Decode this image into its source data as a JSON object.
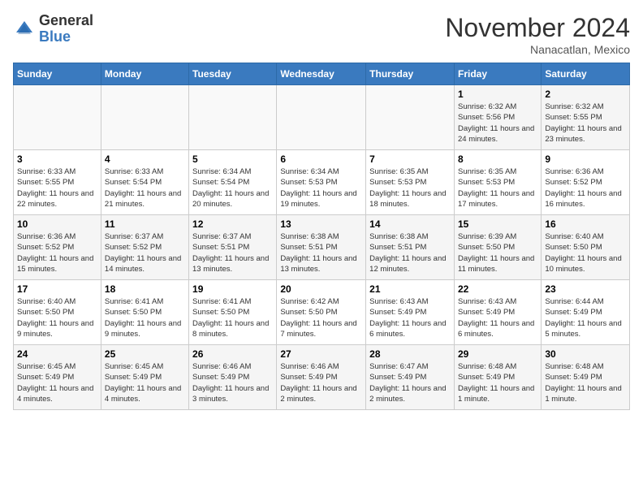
{
  "header": {
    "logo_general": "General",
    "logo_blue": "Blue",
    "month_title": "November 2024",
    "subtitle": "Nanacatlan, Mexico"
  },
  "days_of_week": [
    "Sunday",
    "Monday",
    "Tuesday",
    "Wednesday",
    "Thursday",
    "Friday",
    "Saturday"
  ],
  "weeks": [
    [
      {
        "day": "",
        "info": ""
      },
      {
        "day": "",
        "info": ""
      },
      {
        "day": "",
        "info": ""
      },
      {
        "day": "",
        "info": ""
      },
      {
        "day": "",
        "info": ""
      },
      {
        "day": "1",
        "info": "Sunrise: 6:32 AM\nSunset: 5:56 PM\nDaylight: 11 hours and 24 minutes."
      },
      {
        "day": "2",
        "info": "Sunrise: 6:32 AM\nSunset: 5:55 PM\nDaylight: 11 hours and 23 minutes."
      }
    ],
    [
      {
        "day": "3",
        "info": "Sunrise: 6:33 AM\nSunset: 5:55 PM\nDaylight: 11 hours and 22 minutes."
      },
      {
        "day": "4",
        "info": "Sunrise: 6:33 AM\nSunset: 5:54 PM\nDaylight: 11 hours and 21 minutes."
      },
      {
        "day": "5",
        "info": "Sunrise: 6:34 AM\nSunset: 5:54 PM\nDaylight: 11 hours and 20 minutes."
      },
      {
        "day": "6",
        "info": "Sunrise: 6:34 AM\nSunset: 5:53 PM\nDaylight: 11 hours and 19 minutes."
      },
      {
        "day": "7",
        "info": "Sunrise: 6:35 AM\nSunset: 5:53 PM\nDaylight: 11 hours and 18 minutes."
      },
      {
        "day": "8",
        "info": "Sunrise: 6:35 AM\nSunset: 5:53 PM\nDaylight: 11 hours and 17 minutes."
      },
      {
        "day": "9",
        "info": "Sunrise: 6:36 AM\nSunset: 5:52 PM\nDaylight: 11 hours and 16 minutes."
      }
    ],
    [
      {
        "day": "10",
        "info": "Sunrise: 6:36 AM\nSunset: 5:52 PM\nDaylight: 11 hours and 15 minutes."
      },
      {
        "day": "11",
        "info": "Sunrise: 6:37 AM\nSunset: 5:52 PM\nDaylight: 11 hours and 14 minutes."
      },
      {
        "day": "12",
        "info": "Sunrise: 6:37 AM\nSunset: 5:51 PM\nDaylight: 11 hours and 13 minutes."
      },
      {
        "day": "13",
        "info": "Sunrise: 6:38 AM\nSunset: 5:51 PM\nDaylight: 11 hours and 13 minutes."
      },
      {
        "day": "14",
        "info": "Sunrise: 6:38 AM\nSunset: 5:51 PM\nDaylight: 11 hours and 12 minutes."
      },
      {
        "day": "15",
        "info": "Sunrise: 6:39 AM\nSunset: 5:50 PM\nDaylight: 11 hours and 11 minutes."
      },
      {
        "day": "16",
        "info": "Sunrise: 6:40 AM\nSunset: 5:50 PM\nDaylight: 11 hours and 10 minutes."
      }
    ],
    [
      {
        "day": "17",
        "info": "Sunrise: 6:40 AM\nSunset: 5:50 PM\nDaylight: 11 hours and 9 minutes."
      },
      {
        "day": "18",
        "info": "Sunrise: 6:41 AM\nSunset: 5:50 PM\nDaylight: 11 hours and 9 minutes."
      },
      {
        "day": "19",
        "info": "Sunrise: 6:41 AM\nSunset: 5:50 PM\nDaylight: 11 hours and 8 minutes."
      },
      {
        "day": "20",
        "info": "Sunrise: 6:42 AM\nSunset: 5:50 PM\nDaylight: 11 hours and 7 minutes."
      },
      {
        "day": "21",
        "info": "Sunrise: 6:43 AM\nSunset: 5:49 PM\nDaylight: 11 hours and 6 minutes."
      },
      {
        "day": "22",
        "info": "Sunrise: 6:43 AM\nSunset: 5:49 PM\nDaylight: 11 hours and 6 minutes."
      },
      {
        "day": "23",
        "info": "Sunrise: 6:44 AM\nSunset: 5:49 PM\nDaylight: 11 hours and 5 minutes."
      }
    ],
    [
      {
        "day": "24",
        "info": "Sunrise: 6:45 AM\nSunset: 5:49 PM\nDaylight: 11 hours and 4 minutes."
      },
      {
        "day": "25",
        "info": "Sunrise: 6:45 AM\nSunset: 5:49 PM\nDaylight: 11 hours and 4 minutes."
      },
      {
        "day": "26",
        "info": "Sunrise: 6:46 AM\nSunset: 5:49 PM\nDaylight: 11 hours and 3 minutes."
      },
      {
        "day": "27",
        "info": "Sunrise: 6:46 AM\nSunset: 5:49 PM\nDaylight: 11 hours and 2 minutes."
      },
      {
        "day": "28",
        "info": "Sunrise: 6:47 AM\nSunset: 5:49 PM\nDaylight: 11 hours and 2 minutes."
      },
      {
        "day": "29",
        "info": "Sunrise: 6:48 AM\nSunset: 5:49 PM\nDaylight: 11 hours and 1 minute."
      },
      {
        "day": "30",
        "info": "Sunrise: 6:48 AM\nSunset: 5:49 PM\nDaylight: 11 hours and 1 minute."
      }
    ]
  ]
}
